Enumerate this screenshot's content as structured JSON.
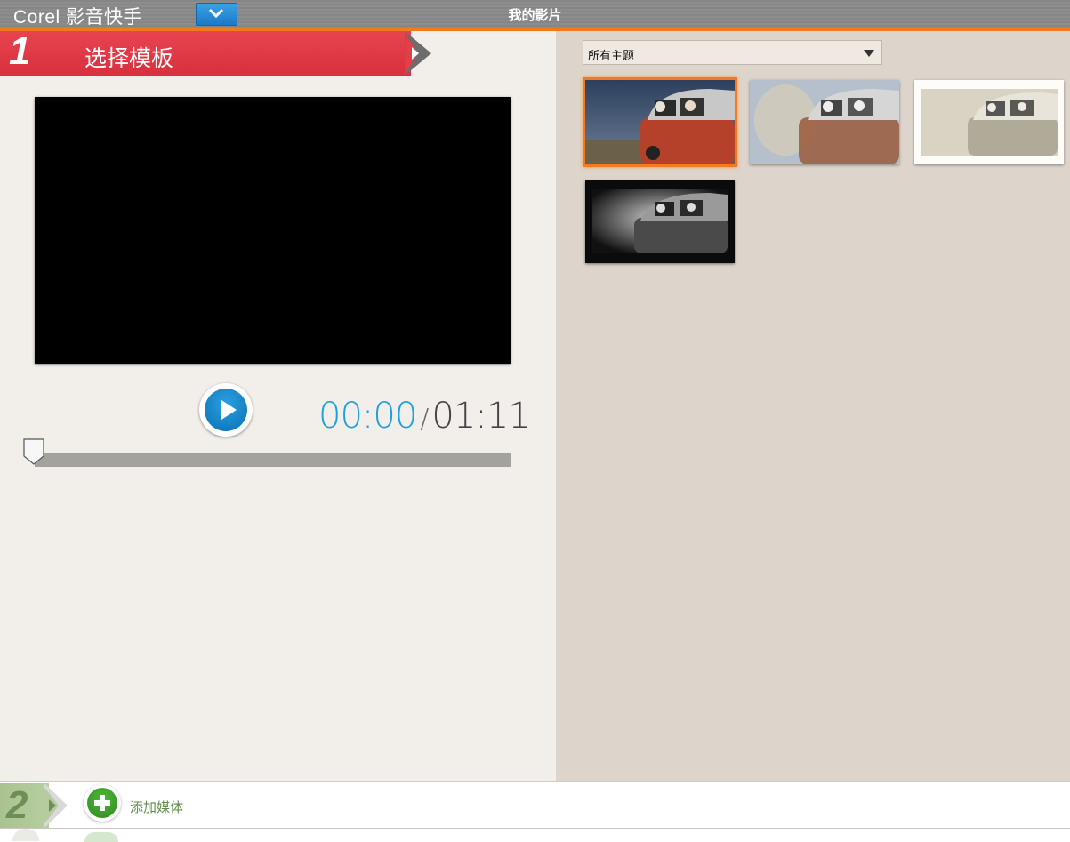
{
  "app": {
    "name": "Corel 影音快手",
    "window_title": "我的影片"
  },
  "step1": {
    "number": "1",
    "title": "选择模板"
  },
  "player": {
    "current_time": "00:00",
    "separator": "/",
    "total_time": "01:11",
    "progress": 0
  },
  "themes": {
    "filter_selected": "所有主题",
    "thumbnails": [
      {
        "name": "theme-1",
        "selected": true,
        "style": "color"
      },
      {
        "name": "theme-2",
        "selected": false,
        "style": "faded"
      },
      {
        "name": "theme-3",
        "selected": false,
        "style": "sepia-frame"
      },
      {
        "name": "theme-4",
        "selected": false,
        "style": "black-white"
      }
    ]
  },
  "step2": {
    "number": "2",
    "add_media_label": "添加媒体"
  },
  "colors": {
    "accent": "#f07a1c",
    "step1": "#e13f4a",
    "play": "#1c87cc",
    "add": "#3a9e2a"
  }
}
